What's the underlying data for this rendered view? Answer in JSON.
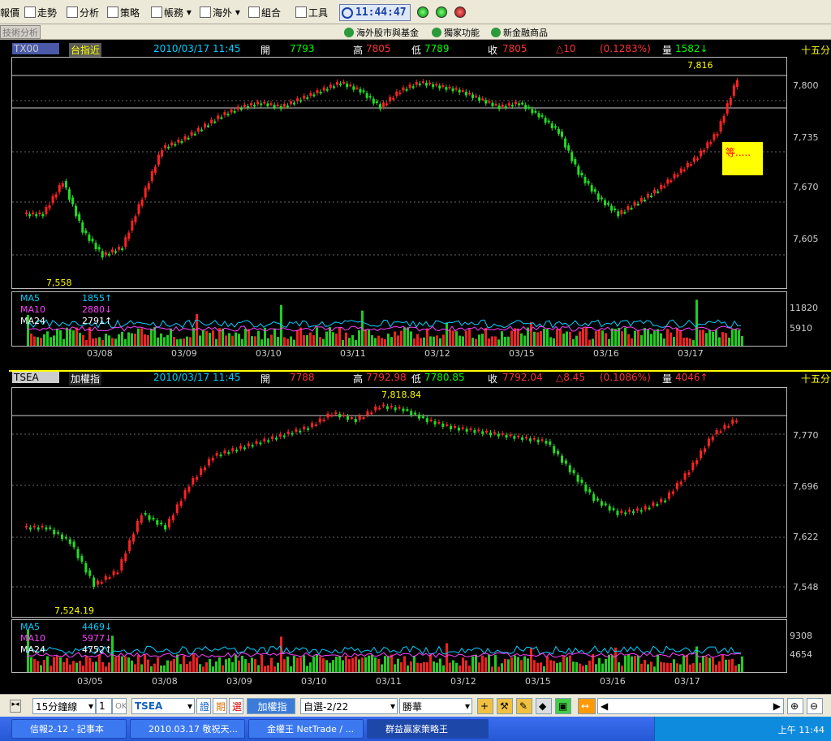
{
  "toolbar": {
    "items": [
      "報價",
      "走勢",
      "分析",
      "策略",
      "帳務",
      "海外",
      "組合",
      "工具"
    ],
    "clock": "11:44:47"
  },
  "toolbar2": {
    "tab": "技術分析",
    "links": [
      "海外股市與基金",
      "獨家功能",
      "新金融商品"
    ]
  },
  "top_panel": {
    "code": "TX00",
    "name": "台指近",
    "datetime": "2010/03/17 11:45",
    "open_label": "開",
    "open": "7793",
    "high_label": "高",
    "high": "7805",
    "low_label": "低",
    "low": "7789",
    "close_label": "收",
    "close": "7805",
    "change": "△10",
    "pct": "(0.1283%)",
    "vol_label": "量",
    "vol": "1582↓",
    "interval": "十五分",
    "yticks": [
      "7,800",
      "7,735",
      "7,670",
      "7,605"
    ],
    "high_mark": "7,816",
    "low_mark": "7,558",
    "note": "等.....",
    "ma": [
      {
        "name": "MA5",
        "value": "1855↑",
        "color": "#00d0ff"
      },
      {
        "name": "MA10",
        "value": "2880↓",
        "color": "#ff40ff"
      },
      {
        "name": "MA24",
        "value": "2791↑",
        "color": "#ffffff"
      }
    ],
    "vol_ticks": [
      "11820",
      "5910"
    ],
    "dates": [
      "03/08",
      "03/09",
      "03/10",
      "03/11",
      "03/12",
      "03/15",
      "03/16",
      "03/17"
    ]
  },
  "bottom_panel": {
    "code": "TSEA",
    "name": "加權指",
    "datetime": "2010/03/17 11:45",
    "open_label": "開",
    "open": "7788",
    "high_label": "高",
    "high": "7792.98",
    "low_label": "低",
    "low": "7780.85",
    "close_label": "收",
    "close": "7792.04",
    "change": "△8.45",
    "pct": "(0.1086%)",
    "vol_label": "量",
    "vol": "4046↑",
    "interval": "十五分",
    "yticks": [
      "7,770",
      "7,696",
      "7,622",
      "7,548"
    ],
    "high_mark": "7,818.84",
    "low_mark": "7,524.19",
    "ma": [
      {
        "name": "MA5",
        "value": "4469↓",
        "color": "#00d0ff"
      },
      {
        "name": "MA10",
        "value": "5977↓",
        "color": "#ff40ff"
      },
      {
        "name": "MA24",
        "value": "4752↑",
        "color": "#ffffff"
      }
    ],
    "vol_ticks": [
      "9308",
      "4654"
    ],
    "dates": [
      "03/05",
      "03/08",
      "03/09",
      "03/10",
      "03/11",
      "03/12",
      "03/15",
      "03/16",
      "03/17"
    ]
  },
  "bottombar": {
    "period": "15分鐘線",
    "count": "1",
    "ok": "OK",
    "symbol": "TSEA",
    "btn1": "證",
    "btn2": "期",
    "btn3": "選",
    "name_btn": "加權指",
    "group": "自選-2/22",
    "broker": "勝華"
  },
  "taskbar": {
    "tasks": [
      "信報2-12 - 記事本",
      "2010.03.17 敬祝天...",
      "金權王 NetTrade / ...",
      "群益贏家策略王"
    ],
    "time": "上午 11:44"
  },
  "chart_data": [
    {
      "type": "candlestick",
      "title": "TX00 台指近 十五分",
      "ylim": [
        7558,
        7816
      ],
      "series": [
        {
          "name": "close",
          "values": [
            7640,
            7680,
            7620,
            7590,
            7600,
            7660,
            7720,
            7730,
            7745,
            7760,
            7770,
            7775,
            7770,
            7780,
            7790,
            7800,
            7790,
            7770,
            7790,
            7800,
            7795,
            7790,
            7780,
            7770,
            7775,
            7760,
            7740,
            7690,
            7660,
            7640,
            7655,
            7670,
            7690,
            7710,
            7740,
            7805
          ]
        }
      ]
    },
    {
      "type": "candlestick",
      "title": "TSEA 加權指 十五分",
      "ylim": [
        7524.19,
        7818.84
      ],
      "series": [
        {
          "name": "close",
          "values": [
            7640,
            7620,
            7560,
            7580,
            7660,
            7640,
            7700,
            7740,
            7750,
            7760,
            7770,
            7780,
            7800,
            7790,
            7810,
            7805,
            7790,
            7780,
            7775,
            7770,
            7765,
            7760,
            7720,
            7680,
            7660,
            7665,
            7680,
            7720,
            7770,
            7792
          ]
        }
      ]
    }
  ]
}
